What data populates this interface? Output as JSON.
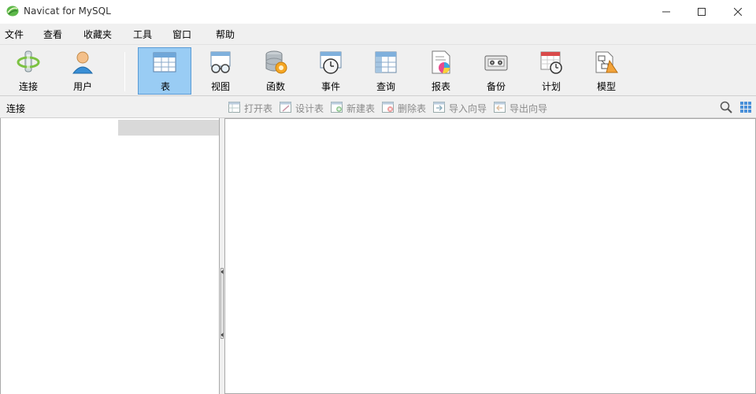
{
  "window": {
    "title": "Navicat for MySQL",
    "min_icon": "minimize-icon",
    "max_icon": "maximize-icon",
    "close_icon": "close-icon"
  },
  "menu": [
    "文件",
    "查看",
    "收藏夹",
    "工具",
    "窗口",
    "帮助"
  ],
  "toolbar": {
    "items": [
      {
        "label": "连接",
        "icon": "connection-icon"
      },
      {
        "label": "用户",
        "icon": "user-icon"
      },
      {
        "label": "表",
        "icon": "table-icon",
        "active": true
      },
      {
        "label": "视图",
        "icon": "view-icon"
      },
      {
        "label": "函数",
        "icon": "function-icon"
      },
      {
        "label": "事件",
        "icon": "event-clock-icon"
      },
      {
        "label": "查询",
        "icon": "query-icon"
      },
      {
        "label": "报表",
        "icon": "report-icon"
      },
      {
        "label": "备份",
        "icon": "backup-tape-icon"
      },
      {
        "label": "计划",
        "icon": "schedule-icon"
      },
      {
        "label": "模型",
        "icon": "model-icon"
      }
    ],
    "active_color": "#99ccf4"
  },
  "subbar": {
    "connection_label": "连接",
    "actions": [
      {
        "label": "打开表",
        "icon": "open-table-icon"
      },
      {
        "label": "设计表",
        "icon": "design-table-icon"
      },
      {
        "label": "新建表",
        "icon": "new-table-icon"
      },
      {
        "label": "删除表",
        "icon": "delete-table-icon"
      },
      {
        "label": "导入向导",
        "icon": "import-wizard-icon"
      },
      {
        "label": "导出向导",
        "icon": "export-wizard-icon"
      }
    ],
    "right_icons": [
      "search-icon",
      "grid-view-icon"
    ]
  }
}
